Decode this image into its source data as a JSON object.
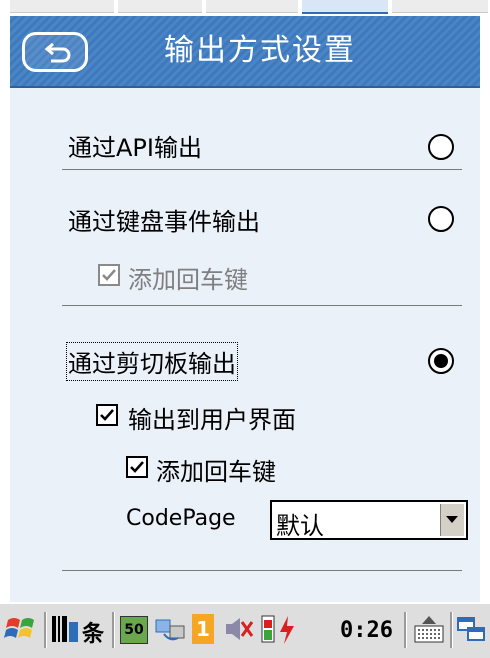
{
  "window": {
    "title": "输出方式设置"
  },
  "options": {
    "api": {
      "label": "通过API输出",
      "selected": false
    },
    "keyboard": {
      "label": "通过键盘事件输出",
      "selected": false,
      "add_enter_label": "添加回车键",
      "add_enter_checked": true,
      "add_enter_enabled": false
    },
    "clipboard": {
      "label": "通过剪切板输出",
      "selected": true,
      "to_ui_label": "输出到用户界面",
      "to_ui_checked": true,
      "add_enter_label": "添加回车键",
      "add_enter_checked": true,
      "codepage_label": "CodePage",
      "codepage_value": "默认"
    }
  },
  "taskbar": {
    "tray_text": "条",
    "badge_number": "50",
    "notify_count": "1",
    "clock": "0:26"
  },
  "colors": {
    "title_bar": "#4a86c7",
    "panel_bg": "#eaf1f9",
    "taskbar_bg": "#dedede"
  },
  "icons": [
    "back-arrow-icon",
    "windows-start-icon",
    "app-icon",
    "battery-icon",
    "network-icon",
    "keyboard-icon",
    "window-switch-icon"
  ]
}
